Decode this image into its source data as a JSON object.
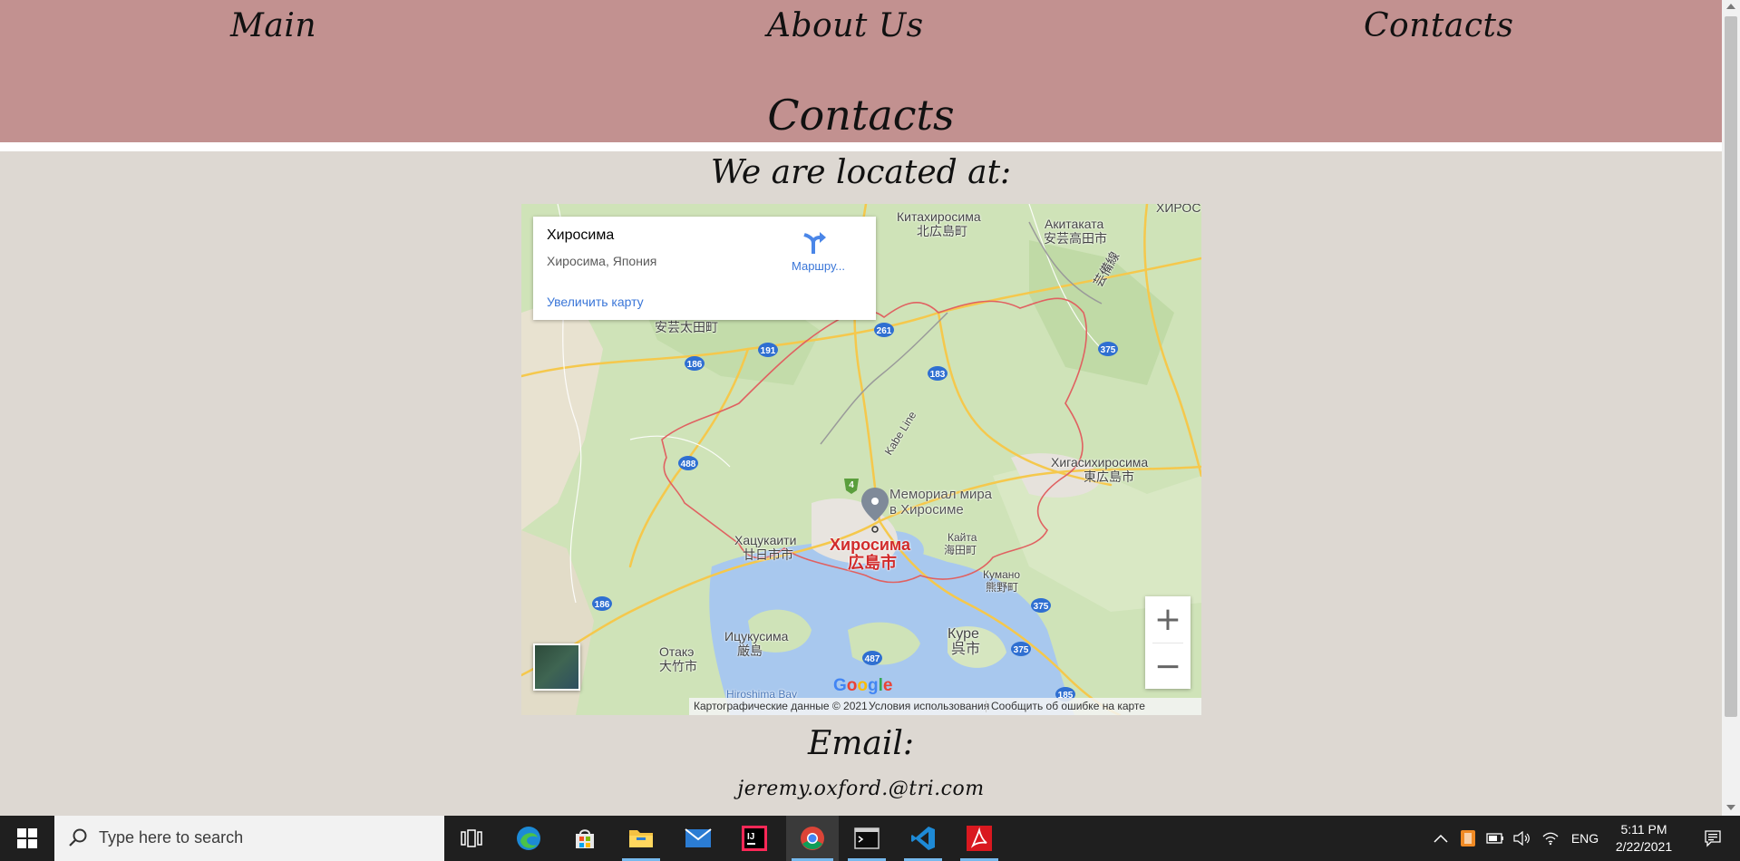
{
  "nav": {
    "main": "Main",
    "about": "About Us",
    "contacts": "Contacts"
  },
  "page_title": "Contacts",
  "located_heading": "We are located at:",
  "map": {
    "place_name": "Хиросима",
    "place_address": "Хиросима, Япония",
    "directions_label": "Маршру...",
    "view_larger": "Увеличить карту",
    "labels": {
      "kitahiroshima_ru": "Китахиросима",
      "kitahiroshima_jp": "北広島町",
      "akitakata_ru": "Акитаката",
      "akitakata_jp": "安芸高田市",
      "hiros_edge": "ХИРОС",
      "geibi_line": "芸備線",
      "akiota_jp": "安芸太田町",
      "higashihiroshima_ru": "Хигасихиросима",
      "higashihiroshima_jp": "東広島市",
      "kabe_line": "Kabe Line",
      "memorial_1": "Мемориал мира",
      "memorial_2": "в Хиросиме",
      "hatsukaichi_ru": "Хацукаити",
      "hatsukaichi_jp": "廿日市市",
      "hiroshima_ru": "Хиросима",
      "hiroshima_jp": "広島市",
      "kaita_ru": "Кайта",
      "kaita_jp": "海田町",
      "kumano_ru": "Кумано",
      "kumano_jp": "熊野町",
      "itsukushima_ru": "Ицукусима",
      "itsukushima_jp": "厳島",
      "otake_ru": "Отакэ",
      "otake_jp": "大竹市",
      "kure_ru": "Куре",
      "kure_jp": "呉市",
      "hiroshima_bay": "Hiroshima Bay",
      "routes": [
        "261",
        "191",
        "186",
        "183",
        "375",
        "488",
        "4",
        "186",
        "375",
        "487",
        "375",
        "185"
      ]
    },
    "google": "Google",
    "attribution": "Картографические данные © 2021",
    "terms": "Условия использования",
    "report": "Сообщить об ошибке на карте",
    "zoom_in": "+",
    "zoom_out": "−"
  },
  "email_heading": "Email:",
  "email": "jeremy.oxford.@tri.com",
  "taskbar": {
    "search_placeholder": "Type here to search",
    "language": "ENG",
    "time": "5:11 PM",
    "date": "2/22/2021"
  },
  "colors": {
    "header_bg": "#c29190",
    "page_bg": "#ddd8d2",
    "link_blue": "#3a76d8",
    "city_red": "#d12b2b",
    "taskbar_bg": "#1f1f1f"
  }
}
